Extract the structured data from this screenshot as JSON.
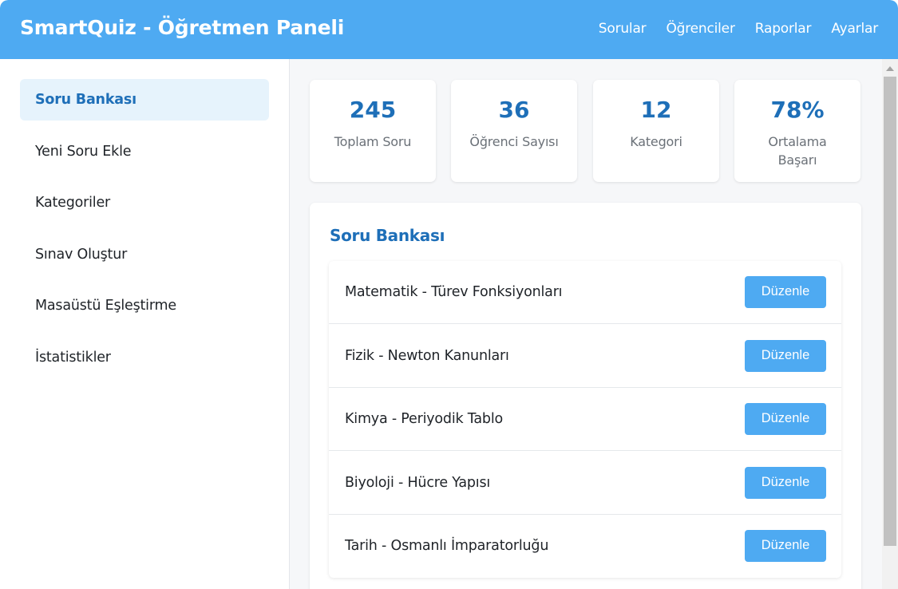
{
  "header": {
    "title": "SmartQuiz - Öğretmen Paneli",
    "nav": [
      "Sorular",
      "Öğrenciler",
      "Raporlar",
      "Ayarlar"
    ]
  },
  "sidebar": {
    "items": [
      {
        "label": "Soru Bankası",
        "active": true
      },
      {
        "label": "Yeni Soru Ekle",
        "active": false
      },
      {
        "label": "Kategoriler",
        "active": false
      },
      {
        "label": "Sınav Oluştur",
        "active": false
      },
      {
        "label": "Masaüstü Eşleştirme",
        "active": false
      },
      {
        "label": "İstatistikler",
        "active": false
      }
    ]
  },
  "stats": [
    {
      "value": "245",
      "label": "Toplam Soru"
    },
    {
      "value": "36",
      "label": "Öğrenci Sayısı"
    },
    {
      "value": "12",
      "label": "Kategori"
    },
    {
      "value": "78%",
      "label": "Ortalama Başarı"
    }
  ],
  "question_bank": {
    "title": "Soru Bankası",
    "questions": [
      {
        "text": "Matematik - Türev Fonksiyonları",
        "action": "Düzenle"
      },
      {
        "text": "Fizik - Newton Kanunları",
        "action": "Düzenle"
      },
      {
        "text": "Kimya - Periyodik Tablo",
        "action": "Düzenle"
      },
      {
        "text": "Biyoloji - Hücre Yapısı",
        "action": "Düzenle"
      },
      {
        "text": "Tarih - Osmanlı İmparatorluğu",
        "action": "Düzenle"
      }
    ]
  },
  "colors": {
    "header": "#4eaaf2",
    "accent": "#1e6fb8",
    "active_bg": "#e6f3fc",
    "button": "#4eaaf2"
  }
}
